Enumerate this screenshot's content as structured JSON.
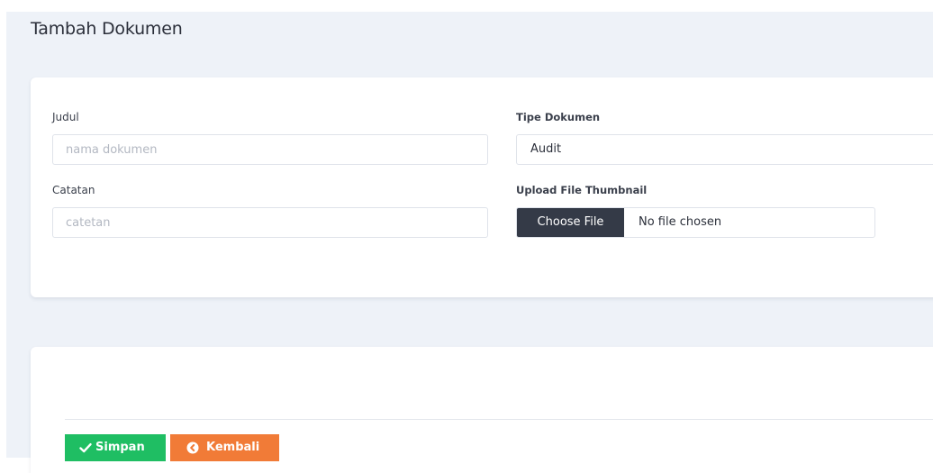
{
  "page": {
    "title": "Tambah Dokumen"
  },
  "form": {
    "judul": {
      "label": "Judul",
      "placeholder": "nama dokumen",
      "value": ""
    },
    "catatan": {
      "label": "Catatan",
      "placeholder": "catetan",
      "value": ""
    },
    "tipe_dokumen": {
      "label": "Tipe Dokumen",
      "selected": "Audit",
      "icon": "chevron-down-icon"
    },
    "upload_thumbnail": {
      "label": "Upload File Thumbnail",
      "button_label": "Choose File",
      "status": "No file chosen"
    }
  },
  "actions": {
    "simpan": {
      "label": "Simpan",
      "icon": "check-icon",
      "color": "#1fbe63"
    },
    "kembali": {
      "label": "Kembali",
      "icon": "circle-arrow-left-icon",
      "color": "#f17b37"
    }
  }
}
